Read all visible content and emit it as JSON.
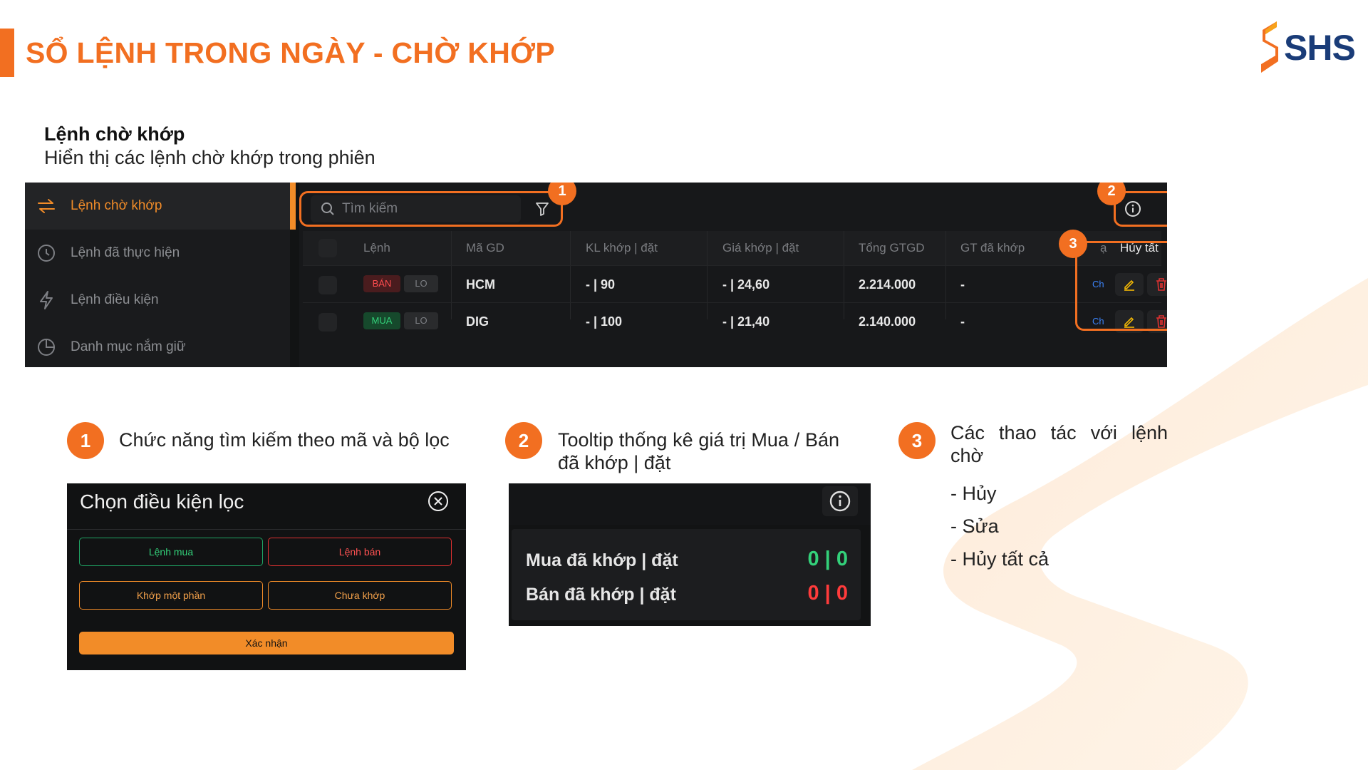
{
  "page": {
    "title": "SỔ LỆNH TRONG NGÀY - CHỜ KHỚP",
    "logo_text": "SHS",
    "section_title": "Lệnh chờ khớp",
    "section_subtitle": "Hiển thị các lệnh chờ khớp trong phiên"
  },
  "sidebar": {
    "items": [
      {
        "label": "Lệnh chờ khớp",
        "icon": "swap-arrows-icon",
        "active": true
      },
      {
        "label": "Lệnh đã thực hiện",
        "icon": "clock-icon",
        "active": false
      },
      {
        "label": "Lệnh điều kiện",
        "icon": "lightning-icon",
        "active": false
      },
      {
        "label": "Danh mục nắm giữ",
        "icon": "pie-chart-icon",
        "active": false
      }
    ]
  },
  "toolbar": {
    "search_placeholder": "Tìm kiếm",
    "search_icon": "search-icon",
    "filter_icon": "filter-icon",
    "info_icon": "info-icon"
  },
  "table": {
    "columns": [
      "Lệnh",
      "Mã GD",
      "KL khớp | đặt",
      "Giá khớp | đặt",
      "Tổng GTGD",
      "GT đã khớp",
      "ạ",
      "Hủy tất cả"
    ],
    "rows": [
      {
        "side": "BÁN",
        "type": "LO",
        "symbol": "HCM",
        "qty": "- | 90",
        "price": "- | 24,60",
        "total": "2.214.000",
        "matched": "-",
        "status": "Ch"
      },
      {
        "side": "MUA",
        "type": "LO",
        "symbol": "DIG",
        "qty": "- | 100",
        "price": "- | 21,40",
        "total": "2.140.000",
        "matched": "-",
        "status": "Ch"
      }
    ]
  },
  "badges": {
    "one": "1",
    "two": "2",
    "three": "3"
  },
  "features": [
    {
      "num": "1",
      "text": "Chức năng tìm kiếm theo mã và bộ lọc"
    },
    {
      "num": "2",
      "text": "Tooltip thống kê giá trị Mua / Bán đã khớp | đặt"
    },
    {
      "num": "3",
      "text": "Các thao tác với lệnh chờ",
      "items": [
        "- Hủy",
        "- Sửa",
        "- Hủy tất cả"
      ]
    }
  ],
  "filter_card": {
    "title": "Chọn điều kiện lọc",
    "buttons": [
      "Lệnh mua",
      "Lệnh bán",
      "Khớp một phần",
      "Chưa khớp"
    ],
    "confirm": "Xác nhận"
  },
  "tooltip_card": {
    "buy_label": "Mua đã khớp | đặt",
    "buy_value": "0 | 0",
    "sell_label": "Bán đã khớp | đặt",
    "sell_value": "0 | 0"
  },
  "colors": {
    "accent": "#f26f21",
    "buy": "#33d17a",
    "sell": "#ff4d4f",
    "brand_blue": "#1a3c78"
  }
}
